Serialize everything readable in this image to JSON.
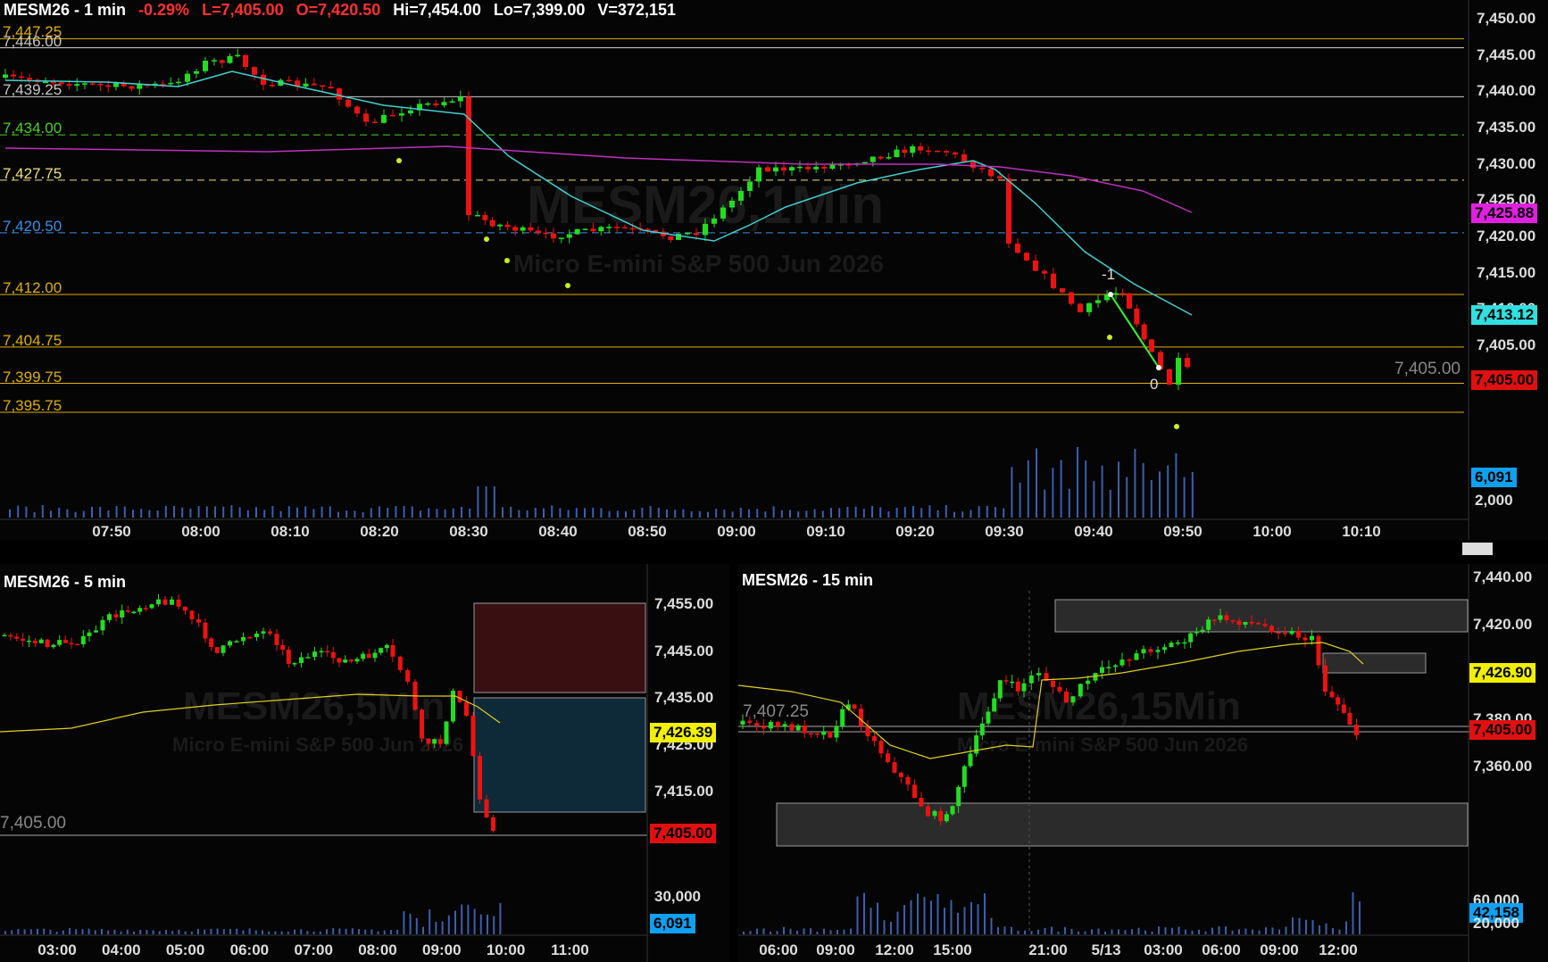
{
  "main": {
    "symbol": "MESM26 - 1 min",
    "change": "-0.29%",
    "last": "L=7,405.00",
    "open": "O=7,420.50",
    "high": "Hi=7,454.00",
    "low": "Lo=7,399.00",
    "volume": "V=372,151",
    "watermark_title": "MESM26,1Min",
    "watermark_sub": "Micro E-mini S&P 500 Jun 2026",
    "levels": [
      {
        "label": "7,447.25",
        "color": "#e0b000",
        "dash": false,
        "price": 7447.25
      },
      {
        "label": "7,446.00",
        "color": "#c8c8c8",
        "dash": false,
        "price": 7446.0
      },
      {
        "label": "7,439.25",
        "color": "#c8c8c8",
        "dash": false,
        "price": 7439.25
      },
      {
        "label": "7,434.00",
        "color": "#4cd020",
        "dash": true,
        "price": 7434.0
      },
      {
        "label": "7,427.75",
        "color": "#f0e080",
        "dash": true,
        "price": 7427.75
      },
      {
        "label": "7,420.50",
        "color": "#3a8fe8",
        "dash": true,
        "price": 7420.5
      },
      {
        "label": "7,412.00",
        "color": "#e0b000",
        "dash": false,
        "price": 7412.0
      },
      {
        "label": "7,404.75",
        "color": "#e0b000",
        "dash": false,
        "price": 7404.75
      },
      {
        "label": "7,399.75",
        "color": "#e0b000",
        "dash": false,
        "price": 7399.75
      },
      {
        "label": "7,395.75",
        "color": "#e0b000",
        "dash": false,
        "price": 7395.75
      }
    ],
    "price_axis": [
      "7,450.00",
      "7,445.00",
      "7,440.00",
      "7,435.00",
      "7,430.00",
      "7,425.00",
      "7,420.00",
      "7,415.00",
      "7,410.00",
      "7,405.00",
      "7,400.00"
    ],
    "tags": {
      "magenta_ma": "7,425.88",
      "cyan_ma": "7,413.12",
      "last_price": "7,405.00",
      "last_price_left": "7,405.00",
      "volume": "6,091",
      "volume_axis": "2,000"
    },
    "times": [
      "07:50",
      "08:00",
      "08:10",
      "08:20",
      "08:30",
      "08:40",
      "08:50",
      "09:00",
      "09:10",
      "09:20",
      "09:30",
      "09:40",
      "09:50",
      "10:00",
      "10:10"
    ],
    "annotations": {
      "top": "-1",
      "bottom": "0"
    }
  },
  "five": {
    "symbol": "MESM26 - 5 min",
    "watermark_title": "MESM26,5Min",
    "watermark_sub": "Micro E-mini S&P 500 Jun 2026",
    "price_axis": [
      "7,455.00",
      "7,445.00",
      "7,435.00",
      "7,425.00",
      "7,415.00"
    ],
    "tags": {
      "ma": "7,426.39",
      "last": "7,405.00",
      "volume": "6,091",
      "volume_axis": "30,000",
      "left_level": "7,405.00"
    },
    "times": [
      "03:00",
      "04:00",
      "05:00",
      "06:00",
      "07:00",
      "08:00",
      "09:00",
      "10:00",
      "11:00"
    ]
  },
  "fifteen": {
    "symbol": "MESM26 - 15 min",
    "watermark_title": "MESM26,15Min",
    "watermark_sub": "Micro E-mini S&P 500 Jun 2026",
    "price_axis": [
      "7,440.00",
      "7,420.00",
      "7,400.00",
      "7,380.00",
      "7,360.00"
    ],
    "tags": {
      "ma": "7,426.90",
      "last": "7,405.00",
      "volume": "42,158",
      "volume_axis_a": "60,000",
      "volume_axis_b": "20,000",
      "left_level": "7,407.25"
    },
    "times": [
      "06:00",
      "09:00",
      "12:00",
      "15:00",
      "21:00",
      "5/13",
      "03:00",
      "06:00",
      "09:00",
      "12:00"
    ]
  },
  "colors": {
    "up": "#22dd22",
    "down": "#ee1111",
    "cyan_ma": "#40d0d0",
    "magenta_ma": "#c030c0",
    "yellow_ma": "#e0d020",
    "tag_magenta": "#e020e0",
    "tag_cyan": "#30e0e0",
    "tag_red": "#e01010",
    "tag_yellow": "#f0f000",
    "tag_blue": "#10a0f0"
  }
}
